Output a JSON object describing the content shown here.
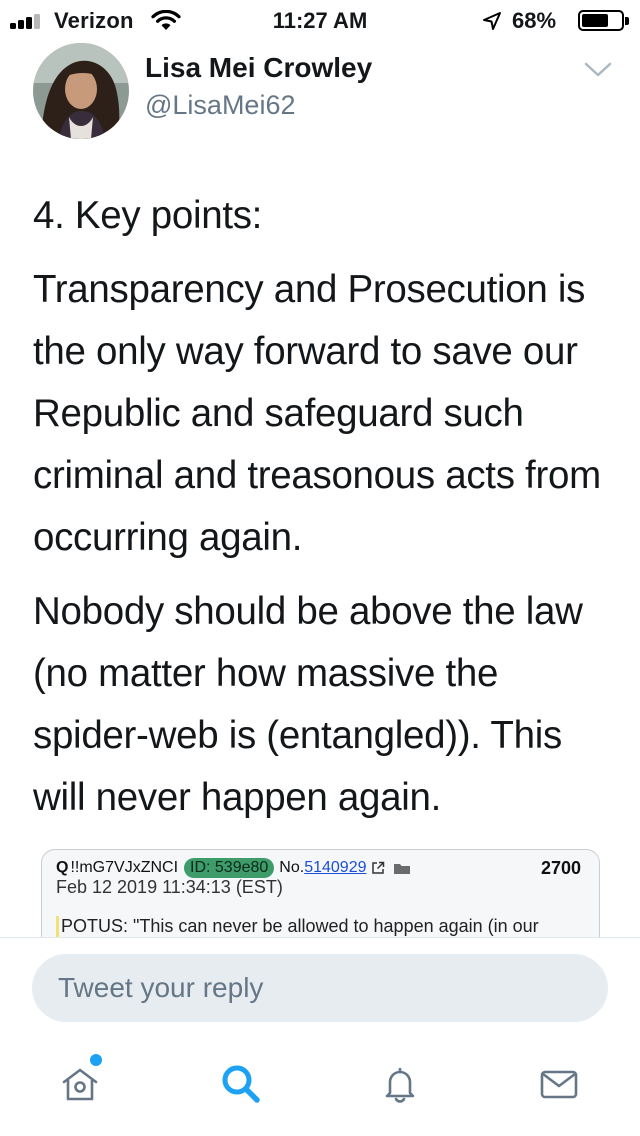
{
  "status_bar": {
    "carrier": "Verizon",
    "time": "11:27 AM",
    "battery_percent": "68%",
    "battery_level": 0.68,
    "signal_bars_filled": 3,
    "signal_bars_total": 4
  },
  "tweet": {
    "display_name": "Lisa Mei Crowley",
    "handle": "@LisaMei62",
    "paragraphs": [
      "4. Key points:",
      "Transparency and Prosecution is the only way forward to save our Republic and safeguard such criminal and treasonous acts from occurring again.",
      "Nobody should be above the law (no matter how massive the spider-web is (entangled)). This will never happen again."
    ]
  },
  "quoted_card": {
    "poster": "Q",
    "tripcode": "!!mG7VJxZNCI",
    "id_badge": "ID: 539e80",
    "post_no_prefix": "No.",
    "post_no": "5140929",
    "count": "2700",
    "date": "Feb 12 2019 11:34:13 (EST)",
    "quote": "POTUS: \"This can never be allowed to happen again (in our"
  },
  "reply": {
    "placeholder": "Tweet your reply"
  },
  "tab_bar": {
    "items": [
      "home-icon",
      "search-icon",
      "bell-icon",
      "mail-icon"
    ],
    "active": "search-icon",
    "accent": "#1da1f2"
  },
  "colors": {
    "text_primary": "#14171a",
    "text_secondary": "#657786",
    "accent": "#1da1f2",
    "reply_bg": "#e6ecf0",
    "id_badge": "#3e9b6a"
  }
}
